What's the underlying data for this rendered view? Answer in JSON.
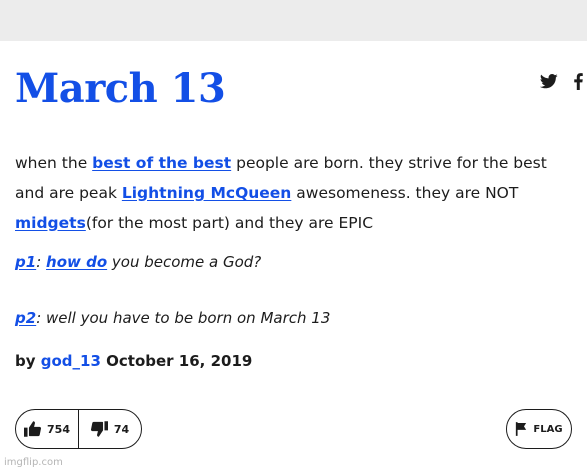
{
  "entry": {
    "title": "March 13",
    "meaning": {
      "t1": "when the ",
      "l1": "best of the best",
      "t2": " people are born. they strive for the best and are peak ",
      "l2": "Lightning McQueen",
      "t3": " awesomeness. they are NOT ",
      "l3": "midgets",
      "t4": "(for the most part) and they are EPIC"
    },
    "example1": {
      "speaker": "p1",
      "sep": ": ",
      "link": "how do",
      "rest": " you become a God?"
    },
    "example2": {
      "speaker": "p2",
      "rest": ": well you have to be born on March 13"
    },
    "contributor": {
      "by": "by ",
      "author": "god_13",
      "date": " October 16, 2019"
    }
  },
  "share": {
    "icons": [
      "twitter-icon",
      "facebook-icon"
    ]
  },
  "votes": {
    "up": "754",
    "down": "74"
  },
  "flag": {
    "label": "FLAG"
  },
  "watermark": "imgflip.com",
  "colors": {
    "accent": "#134fe6",
    "text": "#1c1c1c",
    "background": "#ececec"
  }
}
